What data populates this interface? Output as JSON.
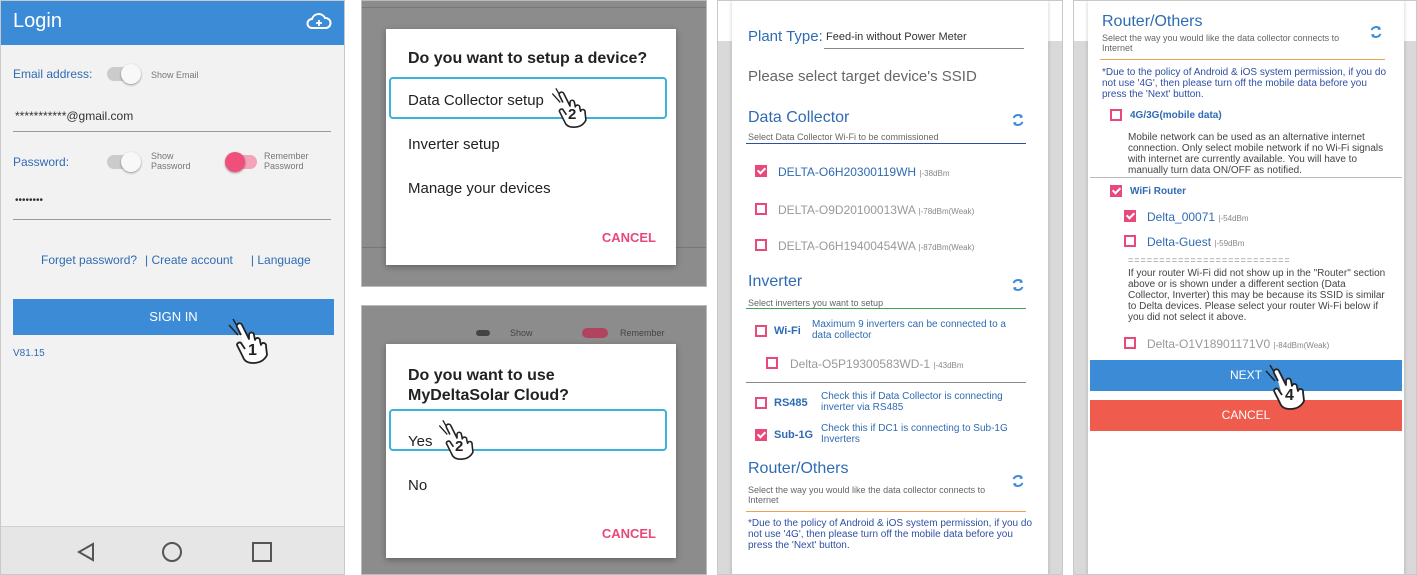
{
  "login": {
    "title": "Login",
    "email_label": "Email address:",
    "show_email": "Show Email",
    "email_value": "***********@gmail.com",
    "password_label": "Password:",
    "show_password": "Show Password",
    "remember_password": "Remember Password",
    "password_value": "••••••••",
    "forget": "Forget password?",
    "create": "| Create account",
    "language": "| Language",
    "signin": "SIGN IN",
    "version": "V81.15",
    "step": "1"
  },
  "setup_dialog": {
    "question": "Do you want to setup a device?",
    "options": [
      "Data Collector setup",
      "Inverter setup",
      "Manage your devices"
    ],
    "cancel": "CANCEL",
    "step": "2"
  },
  "cloud_dialog": {
    "question": "Do you want to use MyDeltaSolar Cloud?",
    "options": [
      "Yes",
      "No"
    ],
    "cancel": "CANCEL",
    "step": "2",
    "bg_show": "Show",
    "bg_remember": "Remember"
  },
  "ssid": {
    "plant_type_label": "Plant Type:",
    "plant_type_value": "Feed-in without Power Meter",
    "select_ssid": "Please select target device's SSID",
    "dc_title": "Data Collector",
    "dc_sub": "Select Data Collector Wi-Fi to be commissioned",
    "dc_items": [
      {
        "name": "DELTA-O6H20300119WH",
        "sig": "|-38dBm"
      },
      {
        "name": "DELTA-O9D20100013WA",
        "sig": "|-78dBm(Weak)"
      },
      {
        "name": "DELTA-O6H19400454WA",
        "sig": "|-87dBm(Weak)"
      }
    ],
    "inv_title": "Inverter",
    "inv_sub": "Select inverters you want to setup",
    "wifi_label": "Wi-Fi",
    "wifi_desc": "Maximum 9 inverters can be connected to a data collector",
    "wifi_item": {
      "name": "Delta-O5P19300583WD-1",
      "sig": "|-43dBm"
    },
    "rs485_label": "RS485",
    "rs485_desc": "Check this if Data Collector is connecting inverter via RS485",
    "sub1g_label": "Sub-1G",
    "sub1g_desc": "Check this if DC1 is connecting to Sub-1G Inverters",
    "router_title": "Router/Others",
    "router_sub": "Select the way you would like the data collector connects to Internet",
    "note": "*Due to the policy of Android & iOS system permission, if you do not use '4G', then please turn off the mobile data before you press the 'Next' button."
  },
  "router": {
    "title": "Router/Others",
    "sub": "Select the way you would like the data collector connects to Internet",
    "note": "*Due to the policy of Android & iOS system permission, if you do not use '4G', then please turn off the mobile data before you press the 'Next' button.",
    "mobile_label": "4G/3G(mobile data)",
    "mobile_desc": "Mobile network can be used as an alternative internet connection. Only select mobile network if no Wi-Fi signals with internet are currently available. You will have to manually turn data ON/OFF as notified.",
    "wifi_router": "WiFi Router",
    "routers": [
      {
        "name": "Delta_00071",
        "sig": "|-54dBm"
      },
      {
        "name": "Delta-Guest",
        "sig": "|-59dBm"
      }
    ],
    "separator": "==========================",
    "hint": "If your router Wi-Fi did not show up in the \"Router\" section above or is shown under a different section (Data Collector, Inverter) this may be because its SSID is similar to Delta devices. Please select your router Wi-Fi below if you did not select it above.",
    "other_item": {
      "name": "Delta-O1V18901171V0",
      "sig": "|-84dBm(Weak)"
    },
    "next": "NEXT",
    "cancel": "CANCEL",
    "step": "4"
  },
  "colors": {
    "accent": "#3b8bd6",
    "pink": "#e8487a",
    "cancel_bg": "#ef5b4c",
    "highlight": "#3fb0de"
  }
}
